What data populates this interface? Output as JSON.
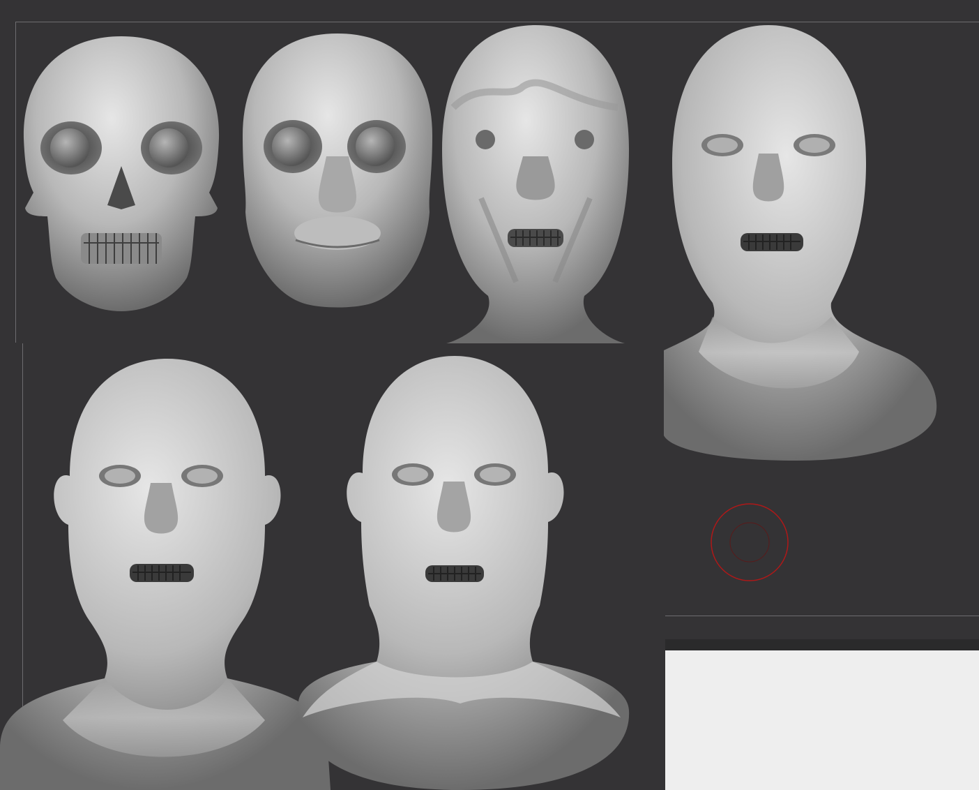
{
  "viewport": {
    "background": "#343335",
    "stages": [
      {
        "id": "skull",
        "icon": "skull-sculpt"
      },
      {
        "id": "muscles",
        "icon": "muscle-layer-sculpt"
      },
      {
        "id": "skin-blockout",
        "icon": "skin-blockout-sculpt"
      },
      {
        "id": "head-neck",
        "icon": "head-neck-sculpt"
      },
      {
        "id": "head-ears",
        "icon": "head-ears-sculpt"
      },
      {
        "id": "head-final",
        "icon": "head-final-sculpt"
      }
    ]
  },
  "brush_cursor": {
    "icon": "brush-cursor-circle",
    "color": "#b01818"
  },
  "lower_pane": {
    "background": "#eeeeee"
  }
}
